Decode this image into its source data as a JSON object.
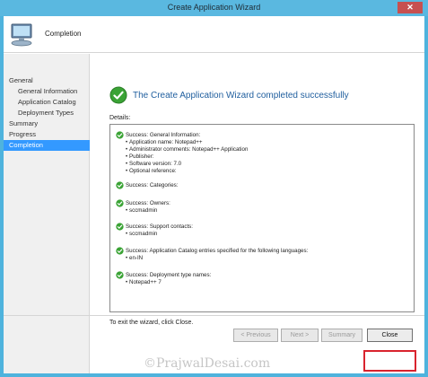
{
  "window": {
    "title": "Create Application Wizard",
    "close_glyph": "✕"
  },
  "header": {
    "title": "Completion",
    "icon": "computer-wizard-icon"
  },
  "sidebar": {
    "items": [
      {
        "label": "General",
        "sub": false,
        "active": false
      },
      {
        "label": "General Information",
        "sub": true,
        "active": false
      },
      {
        "label": "Application Catalog",
        "sub": true,
        "active": false
      },
      {
        "label": "Deployment Types",
        "sub": true,
        "active": false
      },
      {
        "label": "Summary",
        "sub": false,
        "active": false
      },
      {
        "label": "Progress",
        "sub": false,
        "active": false
      },
      {
        "label": "Completion",
        "sub": false,
        "active": true
      }
    ]
  },
  "main": {
    "success_message": "The Create Application Wizard completed successfully",
    "details_label": "Details:",
    "exit_text": "To exit the wizard, click Close."
  },
  "details": [
    {
      "title": "Success: General Information:",
      "bullets": [
        "Application name: Notepad++",
        "Administrator comments: Notepad++ Application",
        "Publisher:",
        "Software version: 7.0",
        "Optional reference:"
      ]
    },
    {
      "title": "Success: Categories:",
      "bullets": []
    },
    {
      "title": "Success: Owners:",
      "bullets": [
        "sccmadmin"
      ]
    },
    {
      "title": "Success: Support contacts:",
      "bullets": [
        "sccmadmin"
      ]
    },
    {
      "title": "Success: Application Catalog entries specified for the following languages:",
      "bullets": [
        "en-IN"
      ]
    },
    {
      "title": "Success: Deployment type names:",
      "bullets": [
        "Notepad++ 7"
      ]
    }
  ],
  "buttons": {
    "previous": "< Previous",
    "next": "Next >",
    "summary": "Summary",
    "close": "Close"
  },
  "watermark": "©PrajwalDesai.com",
  "colors": {
    "success_green": "#3aa335",
    "accent_blue": "#3399ff",
    "highlight_red": "#d9232e"
  }
}
